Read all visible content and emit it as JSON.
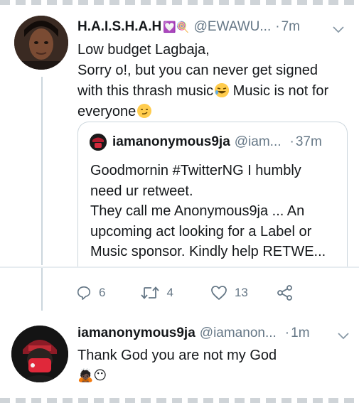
{
  "tweet1": {
    "display_name": "H.A.I.S.H.A.H",
    "name_emoji": "💟🍭",
    "handle": "@EWAWU...",
    "separator": "·",
    "time": "7m",
    "lines": [
      "Low budget Lagbaja,",
      "Sorry o!, but you can never get signed",
      "with this thrash music",
      "Music is not for",
      "everyone"
    ],
    "emoji_laugh": "🤣",
    "emoji_smirk": "😏"
  },
  "quoted_tweet": {
    "display_name": "iamanonymous9ja",
    "handle": "@iam...",
    "separator": "·",
    "time": "37m",
    "lines": [
      "Goodmornin #TwitterNG I humbly",
      "need ur retweet.",
      "They call me Anonymous9ja ... An",
      "upcoming act looking for a Label or",
      "Music sponsor. Kindly help RETWE..."
    ]
  },
  "actions": {
    "replies": "6",
    "retweets": "4",
    "likes": "13"
  },
  "tweet2": {
    "display_name": "iamanonymous9ja",
    "handle": "@iamanon...",
    "separator": "·",
    "time": "1m",
    "text": "Thank God you are not my God",
    "emojis": "🙇🏿😶"
  },
  "colors": {
    "text": "#14171a",
    "secondary": "#657786",
    "border": "#ccd6dd",
    "emoji_yellow": "#ffcc4d"
  },
  "icons": [
    "chevron-down-icon",
    "reply-icon",
    "retweet-icon",
    "like-icon",
    "share-icon"
  ]
}
